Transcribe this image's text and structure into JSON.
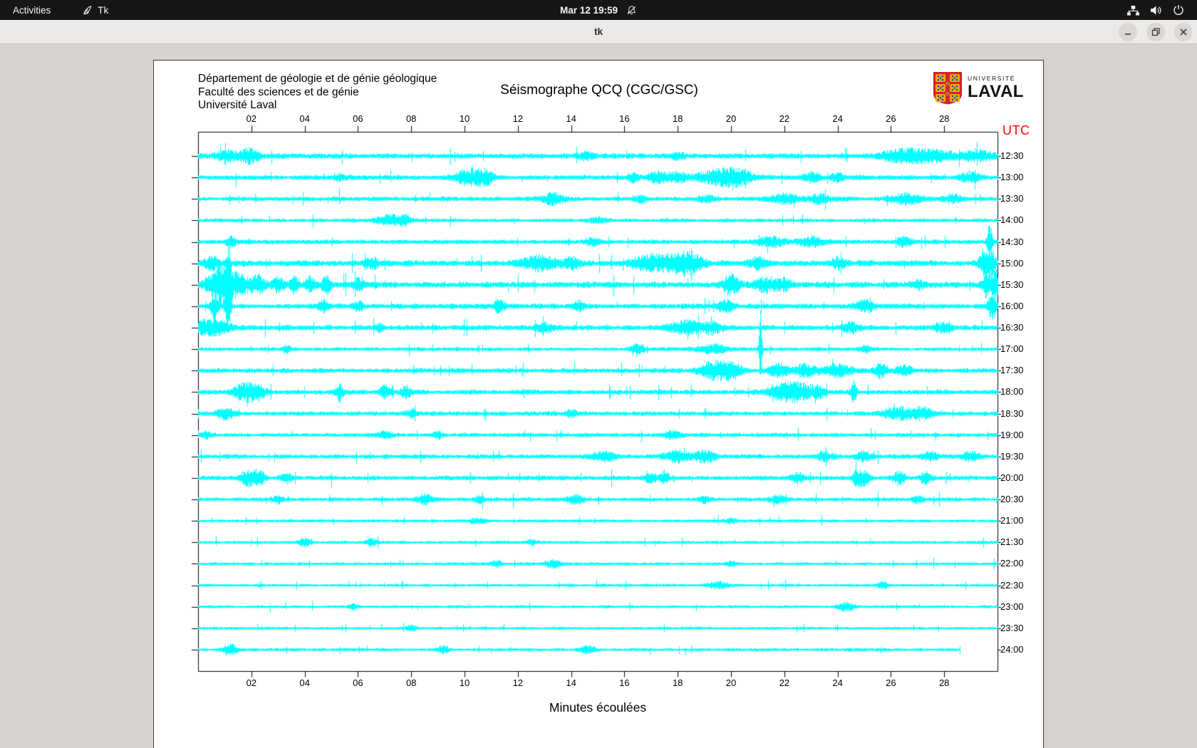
{
  "top_bar": {
    "activities_label": "Activities",
    "app_name": "Tk",
    "clock": "Mar 12 19:59",
    "status_icons": [
      "network",
      "volume",
      "power"
    ],
    "notifications_muted": true
  },
  "window": {
    "title": "tk",
    "controls": [
      "minimize",
      "maximize",
      "close"
    ]
  },
  "seismograph": {
    "dept_lines": [
      "Département de géologie et de génie géologique",
      "Faculté des sciences et de génie",
      "Université Laval"
    ],
    "title": "Séismographe QCQ (CGC/GSC)",
    "logo": {
      "top": "UNIVERSITÉ",
      "bottom": "LAVAL"
    },
    "utc_label": "UTC",
    "xlabel": "Minutes écoulées",
    "colors": {
      "trace": "#00ffff",
      "utc_label": "#ff0000",
      "axis": "#000000"
    }
  },
  "chart_data": {
    "type": "line",
    "title": "Séismographe QCQ (CGC/GSC)",
    "xlabel": "Minutes écoulées",
    "ylabel": "UTC",
    "x_range_minutes": [
      0,
      30
    ],
    "x_ticks": [
      "02",
      "04",
      "06",
      "08",
      "10",
      "12",
      "14",
      "16",
      "18",
      "20",
      "22",
      "24",
      "26",
      "28"
    ],
    "grid": false,
    "rows": [
      {
        "label": "12:30",
        "base": 2.6,
        "end": 30,
        "events": [
          [
            1.3,
            0.6,
            5
          ],
          [
            2.0,
            0.3,
            6
          ],
          [
            14.5,
            0.3,
            4
          ],
          [
            18.0,
            0.2,
            4
          ],
          [
            26.3,
            0.8,
            5
          ],
          [
            27.5,
            1.0,
            6
          ],
          [
            29.3,
            0.5,
            6
          ]
        ]
      },
      {
        "label": "13:00",
        "base": 2.4,
        "end": 30,
        "events": [
          [
            5.3,
            0.15,
            4
          ],
          [
            10.2,
            0.5,
            10
          ],
          [
            10.8,
            0.3,
            7
          ],
          [
            16.3,
            0.2,
            5
          ],
          [
            17.3,
            0.4,
            6
          ],
          [
            18.0,
            0.3,
            6
          ],
          [
            19.5,
            0.8,
            8
          ],
          [
            20.3,
            0.5,
            7
          ],
          [
            23.0,
            0.3,
            6
          ],
          [
            24.0,
            0.2,
            5
          ],
          [
            29.0,
            0.4,
            5
          ]
        ]
      },
      {
        "label": "13:30",
        "base": 2.2,
        "end": 30,
        "events": [
          [
            13.3,
            0.4,
            6
          ],
          [
            16.6,
            0.2,
            4
          ],
          [
            19.0,
            0.3,
            4
          ],
          [
            22.0,
            0.5,
            5
          ],
          [
            23.3,
            0.4,
            5
          ],
          [
            26.6,
            0.6,
            6
          ],
          [
            28.3,
            0.3,
            5
          ]
        ]
      },
      {
        "label": "14:00",
        "base": 1.8,
        "end": 30,
        "events": [
          [
            7.2,
            0.5,
            6
          ],
          [
            7.8,
            0.2,
            5
          ],
          [
            15.0,
            0.3,
            3
          ]
        ]
      },
      {
        "label": "14:30",
        "base": 2.2,
        "end": 30,
        "events": [
          [
            1.2,
            0.2,
            5
          ],
          [
            14.8,
            0.3,
            4
          ],
          [
            21.5,
            0.6,
            5
          ],
          [
            23.0,
            0.5,
            5
          ],
          [
            26.5,
            0.3,
            5
          ],
          [
            29.7,
            0.1,
            22
          ]
        ]
      },
      {
        "label": "15:00",
        "base": 3.0,
        "end": 30,
        "events": [
          [
            0.5,
            0.3,
            6
          ],
          [
            6.5,
            0.3,
            5
          ],
          [
            12.8,
            0.6,
            8
          ],
          [
            14.0,
            0.3,
            6
          ],
          [
            16.8,
            0.5,
            8
          ],
          [
            17.8,
            0.6,
            10
          ],
          [
            18.5,
            0.4,
            9
          ],
          [
            21.0,
            0.3,
            6
          ],
          [
            24.0,
            0.3,
            6
          ],
          [
            29.5,
            0.2,
            14
          ],
          [
            29.8,
            0.1,
            20
          ]
        ]
      },
      {
        "label": "15:30",
        "base": 3.0,
        "end": 30,
        "events": [
          [
            0.5,
            0.3,
            10
          ],
          [
            0.9,
            0.25,
            22
          ],
          [
            1.15,
            0.1,
            40
          ],
          [
            1.5,
            0.3,
            14
          ],
          [
            2.2,
            0.3,
            10
          ],
          [
            3.0,
            0.2,
            8
          ],
          [
            3.6,
            0.15,
            10
          ],
          [
            4.2,
            0.2,
            8
          ],
          [
            4.8,
            0.15,
            12
          ],
          [
            6.0,
            0.2,
            6
          ],
          [
            20.0,
            0.3,
            11
          ],
          [
            21.3,
            0.4,
            7
          ],
          [
            22.0,
            0.3,
            6
          ],
          [
            27.0,
            0.2,
            5
          ],
          [
            29.6,
            0.15,
            16
          ],
          [
            29.9,
            0.1,
            22
          ]
        ]
      },
      {
        "label": "16:00",
        "base": 2.6,
        "end": 30,
        "events": [
          [
            0.6,
            0.15,
            14
          ],
          [
            1.1,
            0.1,
            30
          ],
          [
            4.7,
            0.2,
            7
          ],
          [
            6.0,
            0.2,
            5
          ],
          [
            11.3,
            0.2,
            6
          ],
          [
            14.3,
            0.2,
            5
          ],
          [
            19.8,
            0.3,
            6
          ],
          [
            25.0,
            0.3,
            6
          ],
          [
            29.8,
            0.15,
            18
          ]
        ]
      },
      {
        "label": "16:30",
        "base": 2.6,
        "end": 30,
        "events": [
          [
            0.3,
            0.4,
            8
          ],
          [
            0.9,
            0.3,
            7
          ],
          [
            6.8,
            0.2,
            4
          ],
          [
            13.0,
            0.3,
            5
          ],
          [
            18.3,
            0.6,
            7
          ],
          [
            19.3,
            0.4,
            6
          ],
          [
            24.5,
            0.3,
            5
          ],
          [
            28.0,
            0.3,
            5
          ]
        ]
      },
      {
        "label": "17:00",
        "base": 1.8,
        "end": 30,
        "events": [
          [
            3.3,
            0.15,
            4
          ],
          [
            16.5,
            0.3,
            5
          ],
          [
            19.3,
            0.6,
            5
          ],
          [
            21.1,
            0.05,
            50
          ],
          [
            25.0,
            0.2,
            4
          ]
        ]
      },
      {
        "label": "17:30",
        "base": 2.4,
        "end": 30,
        "events": [
          [
            19.3,
            0.5,
            10
          ],
          [
            20.0,
            0.4,
            8
          ],
          [
            21.8,
            0.4,
            7
          ],
          [
            22.8,
            0.4,
            7
          ],
          [
            24.0,
            0.5,
            7
          ],
          [
            25.6,
            0.2,
            9
          ],
          [
            26.5,
            0.3,
            6
          ]
        ]
      },
      {
        "label": "18:00",
        "base": 2.4,
        "end": 30,
        "events": [
          [
            1.7,
            0.4,
            9
          ],
          [
            2.2,
            0.3,
            8
          ],
          [
            5.3,
            0.15,
            9
          ],
          [
            7.0,
            0.2,
            7
          ],
          [
            7.8,
            0.2,
            6
          ],
          [
            21.8,
            0.5,
            8
          ],
          [
            22.5,
            0.4,
            10
          ],
          [
            23.2,
            0.3,
            7
          ],
          [
            24.6,
            0.1,
            12
          ]
        ]
      },
      {
        "label": "18:30",
        "base": 2.2,
        "end": 30,
        "events": [
          [
            1.0,
            0.3,
            6
          ],
          [
            8.0,
            0.2,
            4
          ],
          [
            14.0,
            0.2,
            4
          ],
          [
            26.3,
            0.6,
            7
          ],
          [
            27.2,
            0.4,
            6
          ]
        ]
      },
      {
        "label": "19:00",
        "base": 2.0,
        "end": 30,
        "events": [
          [
            0.3,
            0.2,
            4
          ],
          [
            7.0,
            0.3,
            4
          ],
          [
            9.0,
            0.2,
            4
          ],
          [
            17.8,
            0.3,
            4
          ]
        ]
      },
      {
        "label": "19:30",
        "base": 2.2,
        "end": 30,
        "events": [
          [
            15.2,
            0.4,
            5
          ],
          [
            18.0,
            0.5,
            6
          ],
          [
            19.0,
            0.4,
            6
          ],
          [
            23.5,
            0.3,
            5
          ],
          [
            25.0,
            0.3,
            5
          ],
          [
            27.5,
            0.3,
            5
          ],
          [
            29.0,
            0.3,
            5
          ]
        ]
      },
      {
        "label": "20:00",
        "base": 2.2,
        "end": 30,
        "events": [
          [
            1.9,
            0.3,
            9
          ],
          [
            2.3,
            0.2,
            7
          ],
          [
            3.3,
            0.2,
            5
          ],
          [
            17.0,
            0.2,
            6
          ],
          [
            17.5,
            0.15,
            8
          ],
          [
            22.5,
            0.2,
            6
          ],
          [
            24.7,
            0.15,
            10
          ],
          [
            25.0,
            0.2,
            8
          ],
          [
            26.3,
            0.2,
            8
          ],
          [
            27.3,
            0.2,
            6
          ]
        ]
      },
      {
        "label": "20:30",
        "base": 1.9,
        "end": 30,
        "events": [
          [
            3.0,
            0.2,
            4
          ],
          [
            8.5,
            0.3,
            5
          ],
          [
            10.5,
            0.2,
            4
          ],
          [
            14.2,
            0.3,
            5
          ],
          [
            19.0,
            0.2,
            4
          ],
          [
            21.8,
            0.3,
            5
          ],
          [
            27.0,
            0.2,
            4
          ]
        ]
      },
      {
        "label": "21:00",
        "base": 1.5,
        "end": 30,
        "events": [
          [
            10.5,
            0.3,
            3
          ],
          [
            20.0,
            0.2,
            3
          ]
        ]
      },
      {
        "label": "21:30",
        "base": 1.5,
        "end": 30,
        "events": [
          [
            4.0,
            0.2,
            5
          ],
          [
            6.5,
            0.2,
            4
          ],
          [
            12.5,
            0.2,
            3
          ]
        ]
      },
      {
        "label": "22:00",
        "base": 1.5,
        "end": 30,
        "events": [
          [
            11.2,
            0.2,
            4
          ],
          [
            13.3,
            0.3,
            5
          ],
          [
            20.0,
            0.2,
            3
          ]
        ]
      },
      {
        "label": "22:30",
        "base": 1.4,
        "end": 30,
        "events": [
          [
            19.5,
            0.4,
            4
          ],
          [
            25.7,
            0.2,
            4
          ]
        ]
      },
      {
        "label": "23:00",
        "base": 1.4,
        "end": 30,
        "events": [
          [
            5.8,
            0.2,
            3
          ],
          [
            24.3,
            0.3,
            5
          ]
        ]
      },
      {
        "label": "23:30",
        "base": 1.3,
        "end": 30,
        "events": [
          [
            8.0,
            0.2,
            3
          ]
        ]
      },
      {
        "label": "24:00",
        "base": 1.5,
        "end": 28.6,
        "events": [
          [
            1.2,
            0.25,
            7
          ],
          [
            9.2,
            0.2,
            4
          ],
          [
            14.6,
            0.3,
            4
          ]
        ]
      }
    ]
  }
}
